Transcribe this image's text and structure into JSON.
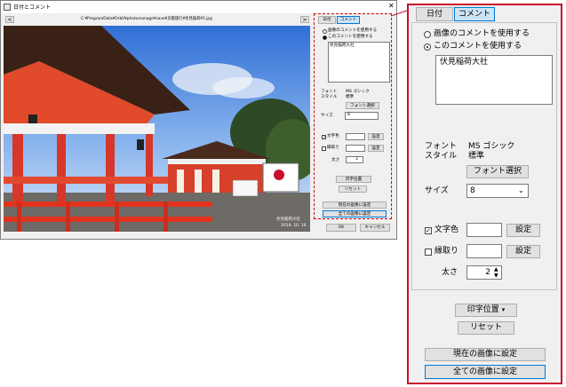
{
  "dialog": {
    "title": "日付とコメント",
    "close_glyph": "✕",
    "file_path": "C:¥ProgramData¥Orbit¥photomanage¥save¥京都旅行¥伏見稲荷¥5.jpg",
    "prev_glyph": "<",
    "next_glyph": ">"
  },
  "photo": {
    "caption_name": "伏見稲荷大社",
    "caption_date": "2019. 10. 10"
  },
  "tabs": {
    "date": "日付",
    "comment": "コメント"
  },
  "comment": {
    "use_image_comment": "画像のコメントを使用する",
    "use_this_comment": "このコメントを使用する",
    "text": "伏見稲荷大社"
  },
  "font": {
    "label": "フォント\nスタイル",
    "name": "MS ゴシック\n標準",
    "select_button": "フォント選択"
  },
  "size": {
    "label": "サイズ",
    "value": "8"
  },
  "text_color": {
    "label": "文字色",
    "checked": true,
    "set_button": "設定"
  },
  "outline": {
    "label": "縁取り",
    "checked": false,
    "set_button": "設定"
  },
  "thickness": {
    "label": "太さ",
    "value": "2"
  },
  "buttons": {
    "print_position": "印字位置",
    "reset": "リセット",
    "apply_current": "現在の画像に設定",
    "apply_all": "全ての画像に設定",
    "ok": "OK",
    "cancel": "キャンセル"
  },
  "colors": {
    "highlight": "#c8102e",
    "selected_tab": "#cce4f7",
    "default_button": "#0078d7"
  }
}
